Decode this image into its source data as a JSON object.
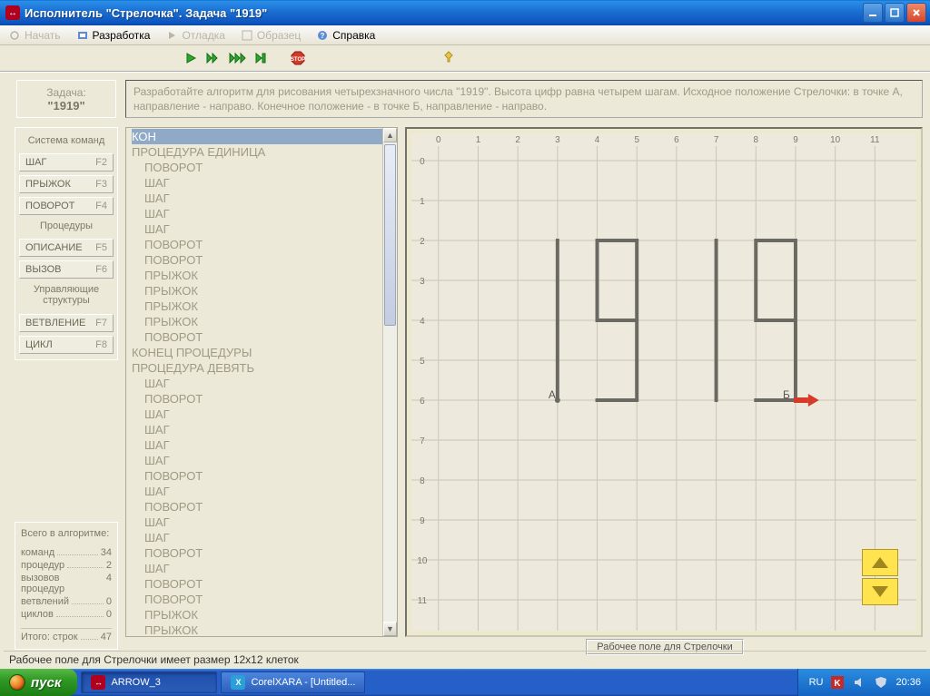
{
  "window": {
    "title": "Исполнитель \"Стрелочка\".  Задача \"1919\""
  },
  "menus": {
    "begin": "Начать",
    "develop": "Разработка",
    "debug": "Отладка",
    "sample": "Образец",
    "help": "Справка"
  },
  "task": {
    "title_label": "Задача:",
    "title_value": "\"1919\"",
    "description": "Разработайте алгоритм для рисования четырехзначного числа \"1919\". Высота цифр равна четырем шагам. Исходное положение Стрелочки: в точке А, направление - направо. Конечное положение - в точке Б, направление - направо."
  },
  "palette": {
    "header": "Система команд",
    "cmds": [
      {
        "label": "ШАГ",
        "key": "F2"
      },
      {
        "label": "ПРЫЖОК",
        "key": "F3"
      },
      {
        "label": "ПОВОРОТ",
        "key": "F4"
      }
    ],
    "procs_label": "Процедуры",
    "procs": [
      {
        "label": "ОПИСАНИЕ",
        "key": "F5"
      },
      {
        "label": "ВЫЗОВ",
        "key": "F6"
      }
    ],
    "ctrl_label": "Управляющие структуры",
    "ctrls": [
      {
        "label": "ВЕТВЛЕНИЕ",
        "key": "F7"
      },
      {
        "label": "ЦИКЛ",
        "key": "F8"
      }
    ]
  },
  "stats": {
    "title": "Всего в алгоритме:",
    "rows": [
      {
        "name": "команд",
        "val": "34"
      },
      {
        "name": "процедур",
        "val": "2"
      },
      {
        "name": "вызовов процедур",
        "val": "4"
      },
      {
        "name": "ветвлений",
        "val": "0"
      },
      {
        "name": "циклов",
        "val": "0"
      }
    ],
    "total_label": "Итого: строк",
    "total_val": "47"
  },
  "code": [
    "КОН",
    "ПРОЦЕДУРА ЕДИНИЦА",
    "  ПОВОРОТ",
    "  ШАГ",
    "  ШАГ",
    "  ШАГ",
    "  ШАГ",
    "  ПОВОРОТ",
    "  ПОВОРОТ",
    "  ПРЫЖОК",
    "  ПРЫЖОК",
    "  ПРЫЖОК",
    "  ПРЫЖОК",
    "  ПОВОРОТ",
    "КОНЕЦ ПРОЦЕДУРЫ",
    "ПРОЦЕДУРА ДЕВЯТЬ",
    "  ШАГ",
    "  ПОВОРОТ",
    "  ШАГ",
    "  ШАГ",
    "  ШАГ",
    "  ШАГ",
    "  ПОВОРОТ",
    "  ШАГ",
    "  ПОВОРОТ",
    "  ШАГ",
    "  ШАГ",
    "  ПОВОРОТ",
    "  ШАГ",
    "  ПОВОРОТ",
    "  ПОВОРОТ",
    "  ПРЫЖОК",
    "  ПРЫЖОК"
  ],
  "canvas": {
    "footer": "Рабочее поле для Стрелочки",
    "point_a": "А",
    "point_b": "Б"
  },
  "sizebar": "Рабочее поле для Стрелочки имеет размер 12x12 клеток",
  "taskbar": {
    "start": "пуск",
    "app1": "ARROW_3",
    "app2": "CorelXARA - [Untitled...",
    "lang": "RU",
    "clock": "20:36"
  }
}
